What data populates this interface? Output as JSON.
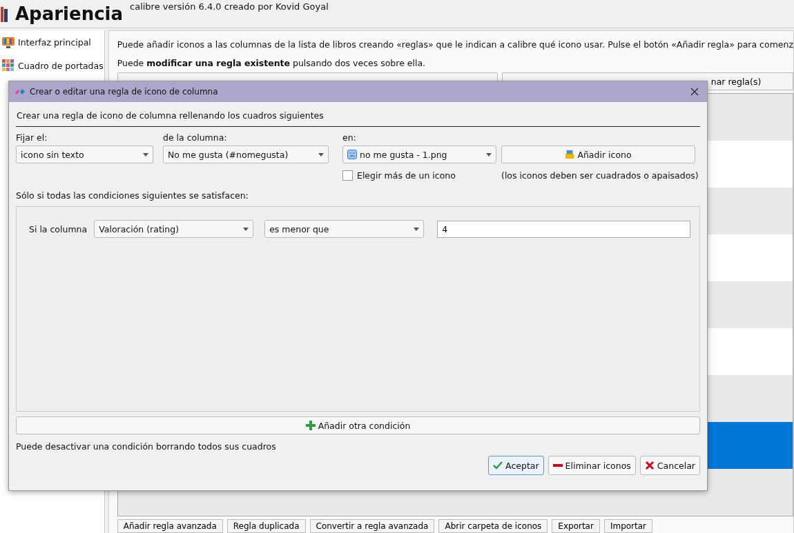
{
  "header": {
    "title": "Apariencia",
    "subtitle": "calibre versión 6.4.0 creado por Kovid Goyal"
  },
  "sidebar": {
    "items": [
      {
        "label": "Interfaz principal",
        "selected": false
      },
      {
        "label": "Cuadro de portadas",
        "selected": false
      }
    ]
  },
  "main": {
    "intro": "Puede añadir iconos a las columnas de la lista de libros creando «reglas» que le indican a calibre qué icono usar. Pulse el botón «Añadir regla» para comenz",
    "hint": "Puede **modificar una regla existente** pulsando dos veces sobre ella.",
    "partial_button": "nar regla(s)",
    "rules": [
      {
        "selected": false
      },
      {
        "selected": false
      },
      {
        "selected": false
      },
      {
        "selected": false
      },
      {
        "selected": false
      },
      {
        "selected": false
      },
      {
        "selected": false
      },
      {
        "selected": true
      },
      {
        "selected": false
      }
    ],
    "bottom_buttons": [
      "Añadir regla avanzada",
      "Regla duplicada",
      "Convertir a regla avanzada",
      "Abrir carpeta de iconos",
      "Exportar",
      "Importar"
    ]
  },
  "dialog": {
    "title": "Crear o editar una regla de icono de columna",
    "heading": "Crear una regla de icono de columna rellenando los cuadros siguientes",
    "set_label": "Fijar el:",
    "set_value": "icono sin texto",
    "column_label": "de la columna:",
    "column_value": "No me gusta (#nomegusta)",
    "icon_label": "en:",
    "icon_value": "no me gusta - 1.png",
    "add_icon": "Añadir icono",
    "multiple": {
      "label": "Elegir más de un icono",
      "checked": false
    },
    "icon_note": "(los iconos deben ser cuadrados o apaisados)",
    "conditions_label": "Sólo si todas las condiciones siguientes se satisfacen:",
    "conditions": [
      {
        "prefix": "Si la columna",
        "column": "Valoración (rating)",
        "operator": "es menor que",
        "value": "4"
      }
    ],
    "add_condition": "Añadir otra condición",
    "footnote": "Puede desactivar una condición borrando todos sus cuadros",
    "buttons": [
      {
        "kind": "ok",
        "label": "Aceptar",
        "selected": true
      },
      {
        "kind": "remove",
        "label": "Eliminar iconos",
        "selected": false
      },
      {
        "kind": "cancel",
        "label": "Cancelar",
        "selected": false
      }
    ]
  }
}
